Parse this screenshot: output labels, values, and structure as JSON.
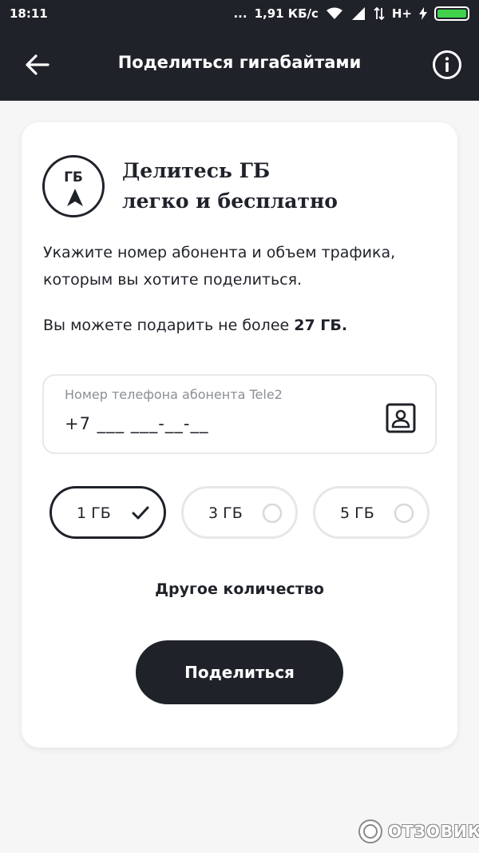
{
  "status_bar": {
    "time": "18:11",
    "dots": "...",
    "speed": "1,91 КБ/с",
    "network": "H+"
  },
  "app_bar": {
    "title": "Поделиться гигабайтами",
    "icons": {
      "back": "arrow-left-icon",
      "info": "info-circle-icon"
    }
  },
  "card": {
    "logo_text": "ГБ",
    "headline_line1": "Делитесь ГБ",
    "headline_line2": "легко и бесплатно",
    "description": "Укажите номер абонента и объем трафика, которым вы хотите поделиться.",
    "limit_prefix": "Вы можете подарить не более ",
    "limit_amount": "27 ГБ.",
    "phone_field": {
      "label": "Номер телефона абонента Tele2",
      "value": "+7 ___ ___-__-__"
    },
    "chips": [
      {
        "label": "1 ГБ",
        "selected": true
      },
      {
        "label": "3 ГБ",
        "selected": false
      },
      {
        "label": "5 ГБ",
        "selected": false
      }
    ],
    "other_amount": "Другое количество",
    "share_button": "Поделиться"
  },
  "watermark": {
    "text": "ОТЗОВИК"
  },
  "colors": {
    "dark": "#1f2229",
    "battery": "#3fd24a",
    "border": "#e6e7e9",
    "muted": "#8b8f96"
  }
}
